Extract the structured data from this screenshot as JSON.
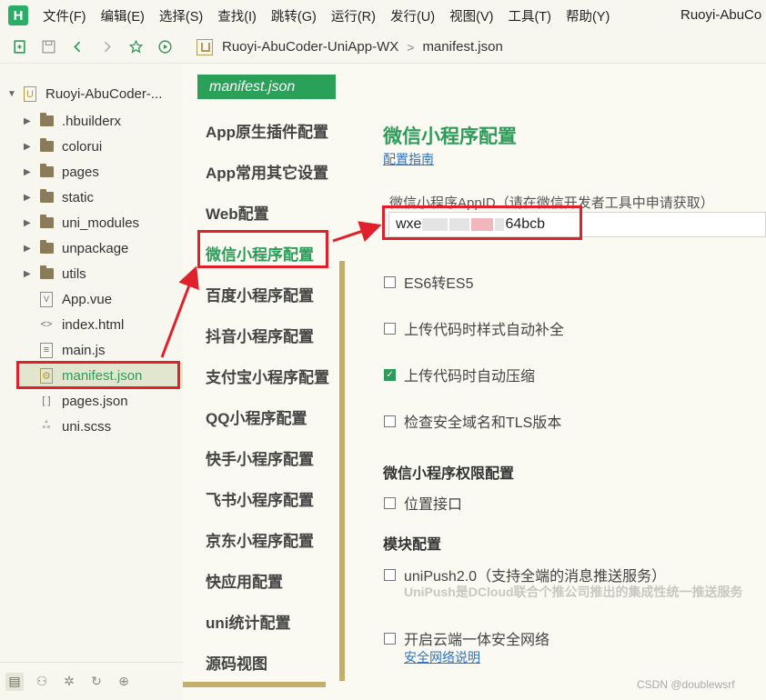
{
  "app": {
    "logo": "H",
    "window_title": "Ruoyi-AbuCo"
  },
  "menu": [
    "文件(F)",
    "编辑(E)",
    "选择(S)",
    "查找(I)",
    "跳转(G)",
    "运行(R)",
    "发行(U)",
    "视图(V)",
    "工具(T)",
    "帮助(Y)"
  ],
  "toolbar": {
    "icons": [
      "new-file-icon",
      "save-icon",
      "back-icon",
      "forward-icon",
      "star-icon",
      "run-icon"
    ]
  },
  "breadcrumb": {
    "project": "Ruoyi-AbuCoder-UniApp-WX",
    "file": "manifest.json",
    "separator": ">"
  },
  "project_tree": {
    "root": "Ruoyi-AbuCoder-...",
    "items": [
      {
        "label": ".hbuilderx",
        "type": "folder"
      },
      {
        "label": "colorui",
        "type": "folder"
      },
      {
        "label": "pages",
        "type": "folder"
      },
      {
        "label": "static",
        "type": "folder"
      },
      {
        "label": "uni_modules",
        "type": "folder"
      },
      {
        "label": "unpackage",
        "type": "folder"
      },
      {
        "label": "utils",
        "type": "folder"
      },
      {
        "label": "App.vue",
        "type": "vue"
      },
      {
        "label": "index.html",
        "type": "html"
      },
      {
        "label": "main.js",
        "type": "js"
      },
      {
        "label": "manifest.json",
        "type": "manifest",
        "selected": true
      },
      {
        "label": "pages.json",
        "type": "json"
      },
      {
        "label": "uni.scss",
        "type": "scss"
      }
    ]
  },
  "bottom_bar": {
    "icons": [
      "project-manager-icon",
      "plugin-icon",
      "debug-icon",
      "git-icon",
      "web-icon"
    ]
  },
  "editor": {
    "tab": "manifest.json",
    "nav": [
      "App原生插件配置",
      "App常用其它设置",
      "Web配置",
      "微信小程序配置",
      "百度小程序配置",
      "抖音小程序配置",
      "支付宝小程序配置",
      "QQ小程序配置",
      "快手小程序配置",
      "飞书小程序配置",
      "京东小程序配置",
      "快应用配置",
      "uni统计配置",
      "源码视图"
    ],
    "active_nav": "微信小程序配置"
  },
  "form": {
    "title": "微信小程序配置",
    "guide_link": "配置指南",
    "appid_label": "微信小程序AppID（请在微信开发者工具中申请获取）",
    "appid_prefix": "wxe",
    "appid_suffix": "64bcb",
    "checks": [
      {
        "label": "ES6转ES5",
        "checked": false
      },
      {
        "label": "上传代码时样式自动补全",
        "checked": false
      },
      {
        "label": "上传代码时自动压缩",
        "checked": true
      },
      {
        "label": "检查安全域名和TLS版本",
        "checked": false
      }
    ],
    "permissions_title": "微信小程序权限配置",
    "location": "位置接口",
    "modules_title": "模块配置",
    "unipush": "uniPush2.0（支持全端的消息推送服务）",
    "unipush_hint": "UniPush是DCloud联合个推公司推出的集成性统一推送服务",
    "secure_network": "开启云端一体安全网络",
    "secure_link": "安全网络说明"
  },
  "colors": {
    "accent": "#2e9b5a",
    "tab": "#2aa059",
    "annotation": "#e0202a",
    "link": "#2f73c4",
    "scroll": "#c3ae6c"
  },
  "watermark": "CSDN @doublewsrf"
}
